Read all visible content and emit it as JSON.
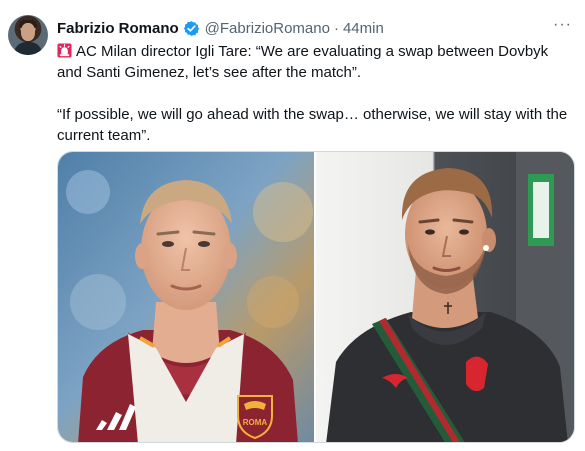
{
  "tweet": {
    "author_name": "Fabrizio Romano",
    "handle": "@FabrizioRomano",
    "separator": "·",
    "time": "44min",
    "more_glyph": "···",
    "paragraph1": "AC Milan director Igli Tare: “We are evaluating a swap between Dovbyk and Santi Gimenez, let’s see after the match”.",
    "paragraph2": "“If possible, we will go ahead with the swap… otherwise, we will stay with the current team”.",
    "icons": {
      "verified": "verified-badge-icon",
      "siren": "rotating-light-emoji",
      "more": "more-options-icon"
    }
  },
  "media": {
    "left_badge_text": "ROMA",
    "colors": {
      "verified": "#1d9bf0",
      "text": "#0f1419",
      "secondary": "#536471",
      "roma_maroon": "#8c2331",
      "milan_red": "#d7262f"
    }
  }
}
